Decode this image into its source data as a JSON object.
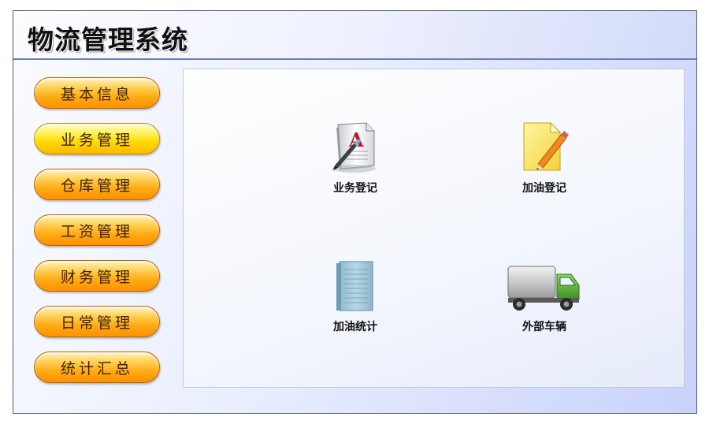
{
  "app": {
    "title": "物流管理系统"
  },
  "sidebar": {
    "items": [
      {
        "label": "基本信息"
      },
      {
        "label": "业务管理",
        "active": true
      },
      {
        "label": "仓库管理"
      },
      {
        "label": "工资管理"
      },
      {
        "label": "财务管理"
      },
      {
        "label": "日常管理"
      },
      {
        "label": "统计汇总"
      }
    ]
  },
  "main": {
    "tiles": [
      {
        "label": "业务登记",
        "icon": "document-a-icon"
      },
      {
        "label": "加油登记",
        "icon": "notepad-pencil-icon"
      },
      {
        "label": "加油统计",
        "icon": "book-icon"
      },
      {
        "label": "外部车辆",
        "icon": "truck-icon"
      }
    ]
  },
  "colors": {
    "button_orange": "#ff9f10",
    "button_yellow": "#ffe000",
    "header_border": "#6c7fb8"
  }
}
